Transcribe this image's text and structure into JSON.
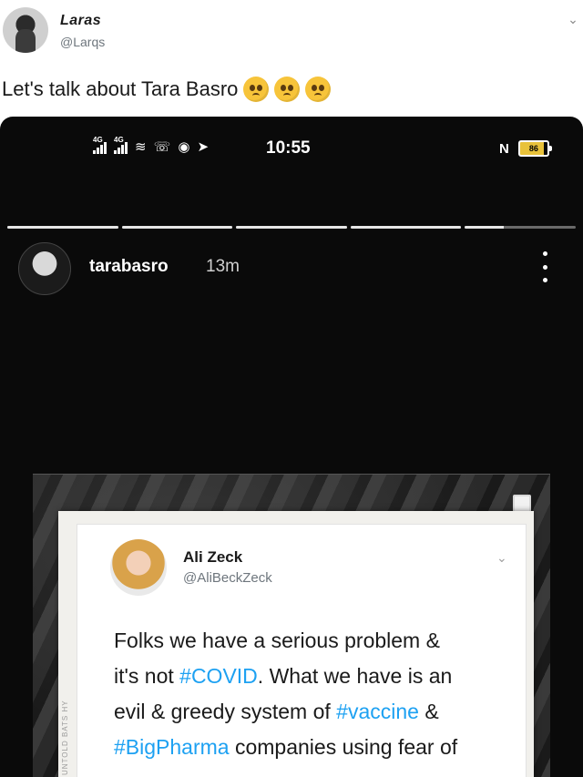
{
  "tweet": {
    "author_name": "Laras",
    "author_handle": "@Larqs",
    "text": "Let's talk about Tara Basro",
    "emoji_count": 3,
    "emoji_name": "pleading-face-emoji"
  },
  "phone": {
    "status_time": "10:55",
    "network_tags": [
      "4G",
      "4G"
    ],
    "battery_level": "86",
    "nfc_label": "N",
    "story_progress": [
      1,
      1,
      1,
      1,
      0.35
    ]
  },
  "story": {
    "username": "tarabasro",
    "posted_ago": "13m"
  },
  "shared_tweet": {
    "author_name": "Ali Zeck",
    "author_handle": "@AliBeckZeck",
    "side_label": "UNTOLD BATS HY",
    "lines": [
      [
        {
          "t": "Folks we have a serious problem &",
          "tag": false
        }
      ],
      [
        {
          "t": "it's not ",
          "tag": false
        },
        {
          "t": "#COVID",
          "tag": true
        },
        {
          "t": ". What we have is an",
          "tag": false
        }
      ],
      [
        {
          "t": "evil & greedy system of ",
          "tag": false
        },
        {
          "t": "#vaccine",
          "tag": true
        },
        {
          "t": " &",
          "tag": false
        }
      ],
      [
        {
          "t": "#BigPharma",
          "tag": true
        },
        {
          "t": " companies using fear of",
          "tag": false
        }
      ]
    ]
  },
  "colors": {
    "hashtag": "#1da1f2",
    "phone_bg": "#0a0a0a",
    "handle_gray": "#6e767d"
  }
}
